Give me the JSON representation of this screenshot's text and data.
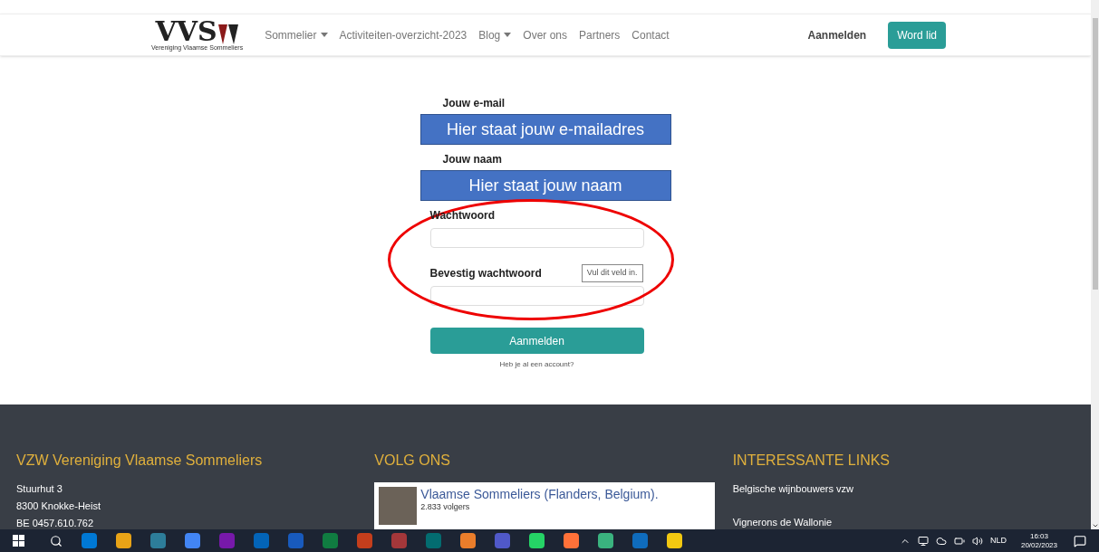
{
  "navbar": {
    "logo": {
      "text": "VVS",
      "tagline": "Vereniging Vlaamse Sommeliers"
    },
    "items": [
      {
        "label": "Sommelier",
        "dropdown": true
      },
      {
        "label": "Activiteiten-overzicht-2023",
        "dropdown": false
      },
      {
        "label": "Blog",
        "dropdown": true
      },
      {
        "label": "Over ons",
        "dropdown": false
      },
      {
        "label": "Partners",
        "dropdown": false
      },
      {
        "label": "Contact",
        "dropdown": false
      }
    ],
    "login": "Aanmelden",
    "signup": "Word lid"
  },
  "form": {
    "fields": [
      {
        "label": "Jouw e-mail",
        "kind": "covered",
        "cover_text": "Hier staat jouw e-mailadres"
      },
      {
        "label": "Jouw naam",
        "kind": "covered",
        "cover_text": "Hier staat jouw naam"
      },
      {
        "label": "Wachtwoord",
        "kind": "input"
      },
      {
        "label": "Bevestig wachtwoord",
        "kind": "input",
        "tooltip": "Vul dit veld in."
      }
    ],
    "circled": true,
    "submit": "Aanmelden",
    "link": "Heb je al een account?"
  },
  "footer": {
    "columns": [
      {
        "heading": "VZW Vereniging Vlaamse Sommeliers",
        "kind": "lines",
        "lines": [
          "Stuurhut 3",
          "8300 Knokke-Heist",
          "BE 0457.610.762"
        ]
      },
      {
        "heading": "VOLG ONS",
        "kind": "widget",
        "widget": {
          "title": "Vlaamse Sommeliers (Flanders, Belgium).",
          "followers": "2.833 volgers"
        }
      },
      {
        "heading": "INTERESSANTE LINKS",
        "kind": "links",
        "lines": [
          "Belgische wijnbouwers vzw",
          "Vignerons de Wallonie"
        ]
      }
    ]
  },
  "taskbar": {
    "language": "NLD",
    "time": "16:03",
    "date": "20/02/2023"
  }
}
